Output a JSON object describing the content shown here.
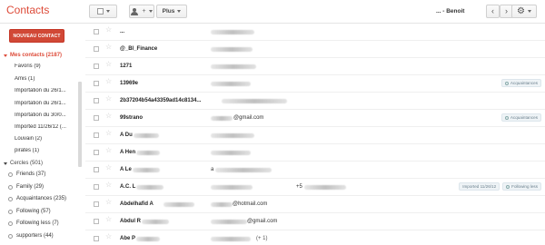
{
  "app": {
    "title": "Contacts"
  },
  "toolbar": {
    "more_label": "Plus",
    "range_text": "... - Benoit"
  },
  "sidebar": {
    "new_contact": "NOUVEAU CONTACT",
    "my_contacts": "Mes contacts (2187)",
    "items": [
      "Favoris (9)",
      "Amis (1)",
      "Importation du 26/1...",
      "Importation du 26/1...",
      "Importation du 30/0...",
      "Imported 11/26/12 (...",
      "Louvain (2)",
      "pirates (1)"
    ],
    "circles_header": "Cercles (501)",
    "circles": [
      "Friends (37)",
      "Family (29)",
      "Acquaintances (235)",
      "Following (57)",
      "Following less (7)",
      "supporters (44)"
    ]
  },
  "contacts": [
    {
      "name": "...",
      "email": "",
      "phone": "",
      "extra": "",
      "tags": []
    },
    {
      "name": "@_Bl_Finance",
      "email": "",
      "phone": "",
      "extra": "",
      "tags": []
    },
    {
      "name": "1271",
      "email": "",
      "phone": "",
      "extra": "",
      "tags": []
    },
    {
      "name": "13969e",
      "email": "",
      "phone": "",
      "extra": "",
      "tags": [
        "Acquaintances"
      ]
    },
    {
      "name": "2b37204b54a43359ad14c8134...",
      "email": "",
      "phone": "",
      "extra": "",
      "tags": []
    },
    {
      "name": "99strano",
      "email": "@gmail.com",
      "phone": "",
      "extra": "",
      "tags": [
        "Acquaintances"
      ]
    },
    {
      "name": "A Du",
      "email": "",
      "phone": "",
      "extra": "",
      "tags": []
    },
    {
      "name": "A Hen",
      "email": "",
      "phone": "",
      "extra": "",
      "tags": []
    },
    {
      "name": "A Le",
      "email": "a",
      "phone": "",
      "extra": "",
      "tags": []
    },
    {
      "name": "A.C. L",
      "email": "",
      "phone": "+5",
      "extra": "",
      "tags": [
        "Imported 11/26/12",
        "Following less"
      ]
    },
    {
      "name": "Abdelhafid A",
      "email": "@hotmail.com",
      "phone": "",
      "extra": "",
      "tags": []
    },
    {
      "name": "Abdul R",
      "email": "@gmail.com",
      "phone": "",
      "extra": "",
      "tags": []
    },
    {
      "name": "Abe P",
      "email": "",
      "phone": "",
      "extra": "(+ 1)",
      "tags": []
    }
  ],
  "colors": {
    "accent": "#dd4b39",
    "button_red": "#d14836"
  },
  "icons": [
    "checkbox-icon",
    "add-person-icon",
    "chevron-left-icon",
    "chevron-right-icon",
    "gear-icon",
    "star-icon",
    "circle-icon"
  ]
}
